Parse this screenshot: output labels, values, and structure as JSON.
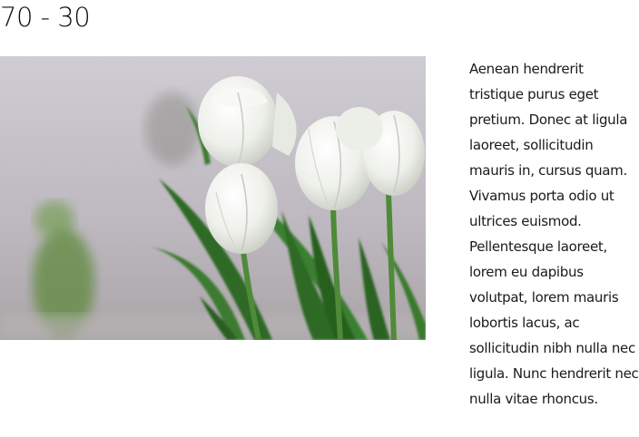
{
  "section": {
    "title": "70 - 30"
  },
  "image": {
    "subject": "white tulips bouquet photo"
  },
  "content": {
    "paragraph": "Aenean hendrerit tristique purus eget pretium. Donec at ligula laoreet, sollicitudin mauris in, cursus quam. Vivamus porta odio ut ultrices euismod. Pellentesque laoreet, lorem eu dapibus volutpat, lorem mauris lobortis lacus, ac sollicitudin nibh nulla nec ligula. Nunc hendrerit nec nulla vitae rhoncus."
  }
}
